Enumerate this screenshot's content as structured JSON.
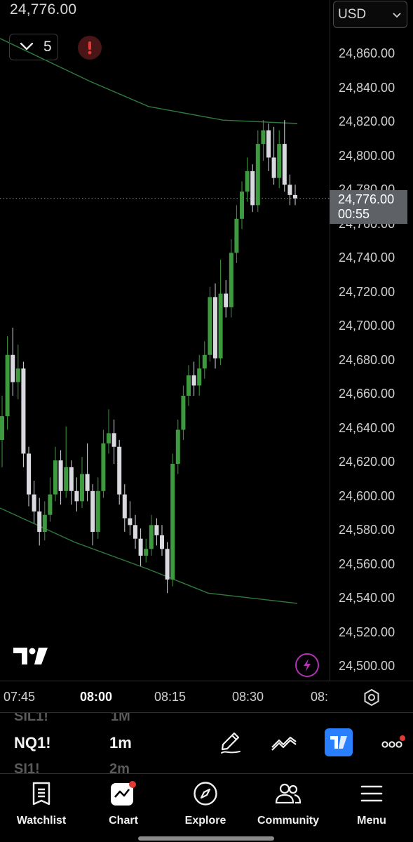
{
  "header": {
    "price": "24,776.00",
    "indicator_count": "5"
  },
  "price_scale": {
    "currency": "USD",
    "ticks": [
      "24,860.00",
      "24,840.00",
      "24,820.00",
      "24,800.00",
      "24,780.00",
      "24,760.00",
      "24,740.00",
      "24,720.00",
      "24,700.00",
      "24,680.00",
      "24,660.00",
      "24,640.00",
      "24,620.00",
      "24,600.00",
      "24,580.00",
      "24,560.00",
      "24,540.00",
      "24,520.00",
      "24,500.00"
    ],
    "last_price": "24,776.00",
    "countdown": "00:55"
  },
  "time_axis": {
    "labels": [
      {
        "text": "07:45",
        "bold": false
      },
      {
        "text": "08:00",
        "bold": true
      },
      {
        "text": "08:15",
        "bold": false
      },
      {
        "text": "08:30",
        "bold": false
      },
      {
        "text": "08:",
        "bold": false
      }
    ]
  },
  "symbol_picker": {
    "rows": [
      {
        "symbol": "SIL1!",
        "interval": "1M",
        "selected": false
      },
      {
        "symbol": "NQ1!",
        "interval": "1m",
        "selected": true
      },
      {
        "symbol": "SI1!",
        "interval": "2m",
        "selected": false
      }
    ]
  },
  "nav": {
    "items": [
      {
        "label": "Watchlist",
        "icon": "watchlist-icon"
      },
      {
        "label": "Chart",
        "icon": "chart-icon"
      },
      {
        "label": "Explore",
        "icon": "compass-icon"
      },
      {
        "label": "Community",
        "icon": "community-icon"
      },
      {
        "label": "Menu",
        "icon": "menu-icon"
      }
    ]
  },
  "colors": {
    "up": "#3e9a3e",
    "down": "#d8dae0",
    "ma_line": "#2f7a3f",
    "last_price_tag": "#5e6166",
    "alert": "#e53935",
    "accent": "#2a7fff",
    "bolt": "#b233b5"
  },
  "chart_data": {
    "type": "candlestick",
    "interval": "1m",
    "price_range": [
      24500,
      24860
    ],
    "last_price": 24776,
    "candles": [
      {
        "o": 24634,
        "c": 24648,
        "h": 24660,
        "l": 24618
      },
      {
        "o": 24648,
        "c": 24684,
        "h": 24695,
        "l": 24640
      },
      {
        "o": 24684,
        "c": 24668,
        "h": 24700,
        "l": 24660
      },
      {
        "o": 24668,
        "c": 24676,
        "h": 24690,
        "l": 24658
      },
      {
        "o": 24676,
        "c": 24626,
        "h": 24680,
        "l": 24618
      },
      {
        "o": 24626,
        "c": 24602,
        "h": 24630,
        "l": 24595
      },
      {
        "o": 24602,
        "c": 24592,
        "h": 24610,
        "l": 24585
      },
      {
        "o": 24592,
        "c": 24580,
        "h": 24600,
        "l": 24572
      },
      {
        "o": 24580,
        "c": 24590,
        "h": 24598,
        "l": 24575
      },
      {
        "o": 24590,
        "c": 24602,
        "h": 24612,
        "l": 24586
      },
      {
        "o": 24602,
        "c": 24622,
        "h": 24630,
        "l": 24598
      },
      {
        "o": 24622,
        "c": 24604,
        "h": 24628,
        "l": 24596
      },
      {
        "o": 24604,
        "c": 24618,
        "h": 24642,
        "l": 24600
      },
      {
        "o": 24618,
        "c": 24604,
        "h": 24622,
        "l": 24596
      },
      {
        "o": 24604,
        "c": 24598,
        "h": 24612,
        "l": 24592
      },
      {
        "o": 24598,
        "c": 24614,
        "h": 24624,
        "l": 24594
      },
      {
        "o": 24614,
        "c": 24604,
        "h": 24632,
        "l": 24598
      },
      {
        "o": 24604,
        "c": 24580,
        "h": 24608,
        "l": 24572
      },
      {
        "o": 24580,
        "c": 24604,
        "h": 24612,
        "l": 24576
      },
      {
        "o": 24604,
        "c": 24632,
        "h": 24640,
        "l": 24600
      },
      {
        "o": 24632,
        "c": 24638,
        "h": 24652,
        "l": 24626
      },
      {
        "o": 24638,
        "c": 24630,
        "h": 24646,
        "l": 24620
      },
      {
        "o": 24630,
        "c": 24602,
        "h": 24634,
        "l": 24596
      },
      {
        "o": 24602,
        "c": 24588,
        "h": 24608,
        "l": 24580
      },
      {
        "o": 24588,
        "c": 24584,
        "h": 24598,
        "l": 24578
      },
      {
        "o": 24584,
        "c": 24576,
        "h": 24590,
        "l": 24570
      },
      {
        "o": 24576,
        "c": 24566,
        "h": 24582,
        "l": 24560
      },
      {
        "o": 24566,
        "c": 24570,
        "h": 24576,
        "l": 24562
      },
      {
        "o": 24570,
        "c": 24584,
        "h": 24590,
        "l": 24566
      },
      {
        "o": 24584,
        "c": 24578,
        "h": 24588,
        "l": 24572
      },
      {
        "o": 24578,
        "c": 24570,
        "h": 24584,
        "l": 24566
      },
      {
        "o": 24570,
        "c": 24552,
        "h": 24574,
        "l": 24544
      },
      {
        "o": 24552,
        "c": 24620,
        "h": 24626,
        "l": 24548
      },
      {
        "o": 24620,
        "c": 24640,
        "h": 24646,
        "l": 24614
      },
      {
        "o": 24640,
        "c": 24660,
        "h": 24666,
        "l": 24634
      },
      {
        "o": 24660,
        "c": 24672,
        "h": 24678,
        "l": 24654
      },
      {
        "o": 24672,
        "c": 24666,
        "h": 24680,
        "l": 24660
      },
      {
        "o": 24666,
        "c": 24676,
        "h": 24684,
        "l": 24660
      },
      {
        "o": 24676,
        "c": 24684,
        "h": 24692,
        "l": 24670
      },
      {
        "o": 24684,
        "c": 24718,
        "h": 24724,
        "l": 24680
      },
      {
        "o": 24718,
        "c": 24682,
        "h": 24726,
        "l": 24676
      },
      {
        "o": 24682,
        "c": 24720,
        "h": 24740,
        "l": 24678
      },
      {
        "o": 24720,
        "c": 24712,
        "h": 24728,
        "l": 24706
      },
      {
        "o": 24712,
        "c": 24744,
        "h": 24752,
        "l": 24706
      },
      {
        "o": 24744,
        "c": 24764,
        "h": 24772,
        "l": 24738
      },
      {
        "o": 24764,
        "c": 24780,
        "h": 24786,
        "l": 24758
      },
      {
        "o": 24780,
        "c": 24792,
        "h": 24800,
        "l": 24774
      },
      {
        "o": 24792,
        "c": 24772,
        "h": 24796,
        "l": 24768
      },
      {
        "o": 24772,
        "c": 24808,
        "h": 24816,
        "l": 24768
      },
      {
        "o": 24808,
        "c": 24816,
        "h": 24822,
        "l": 24798
      },
      {
        "o": 24816,
        "c": 24800,
        "h": 24820,
        "l": 24792
      },
      {
        "o": 24800,
        "c": 24788,
        "h": 24818,
        "l": 24784
      },
      {
        "o": 24788,
        "c": 24808,
        "h": 24816,
        "l": 24782
      },
      {
        "o": 24808,
        "c": 24784,
        "h": 24822,
        "l": 24780
      },
      {
        "o": 24784,
        "c": 24778,
        "h": 24790,
        "l": 24772
      },
      {
        "o": 24778,
        "c": 24776,
        "h": 24784,
        "l": 24772
      }
    ],
    "ma_upper": [
      [
        0,
        24870
      ],
      [
        0.3,
        24845
      ],
      [
        0.5,
        24830
      ],
      [
        0.75,
        24822
      ],
      [
        1,
        24820
      ]
    ],
    "ma_lower": [
      [
        0,
        24594
      ],
      [
        0.25,
        24574
      ],
      [
        0.5,
        24558
      ],
      [
        0.7,
        24544
      ],
      [
        1,
        24538
      ]
    ]
  }
}
